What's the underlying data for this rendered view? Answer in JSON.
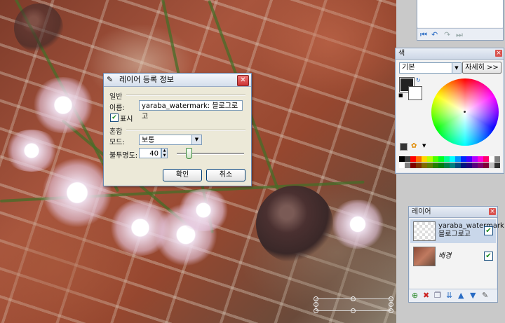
{
  "dialog": {
    "title": "레이어 등록 정보",
    "group_general": "일반",
    "name_label": "이름:",
    "name_value": "yaraba_watermark: 블로그로고",
    "visible_label": "표시",
    "visible_checked": true,
    "group_blend": "혼합",
    "mode_label": "모드:",
    "mode_value": "보통",
    "opacity_label": "불투명도:",
    "opacity_value": "40",
    "opacity_fraction": 0.4,
    "ok_label": "확인",
    "cancel_label": "취소"
  },
  "colors_panel": {
    "title": "색",
    "mode_value": "기본",
    "more_label": "자세히 >>",
    "primary_color": "#222222",
    "secondary_color": "#ffffff"
  },
  "layers_panel": {
    "title": "레이어",
    "layers": [
      {
        "name": "yaraba_watermark: 블로그로고",
        "visible": true,
        "selected": true
      },
      {
        "name": "배경",
        "visible": true,
        "selected": false
      }
    ]
  },
  "icons": {
    "dialog": "layer-properties-icon",
    "close": "close-icon",
    "history": [
      "first-step-icon",
      "undo-icon",
      "redo-icon",
      "last-step-icon"
    ],
    "layers_toolbar": [
      "add-layer-icon",
      "delete-layer-icon",
      "duplicate-layer-icon",
      "merge-down-icon",
      "move-up-icon",
      "move-down-icon",
      "layer-properties-icon"
    ]
  }
}
